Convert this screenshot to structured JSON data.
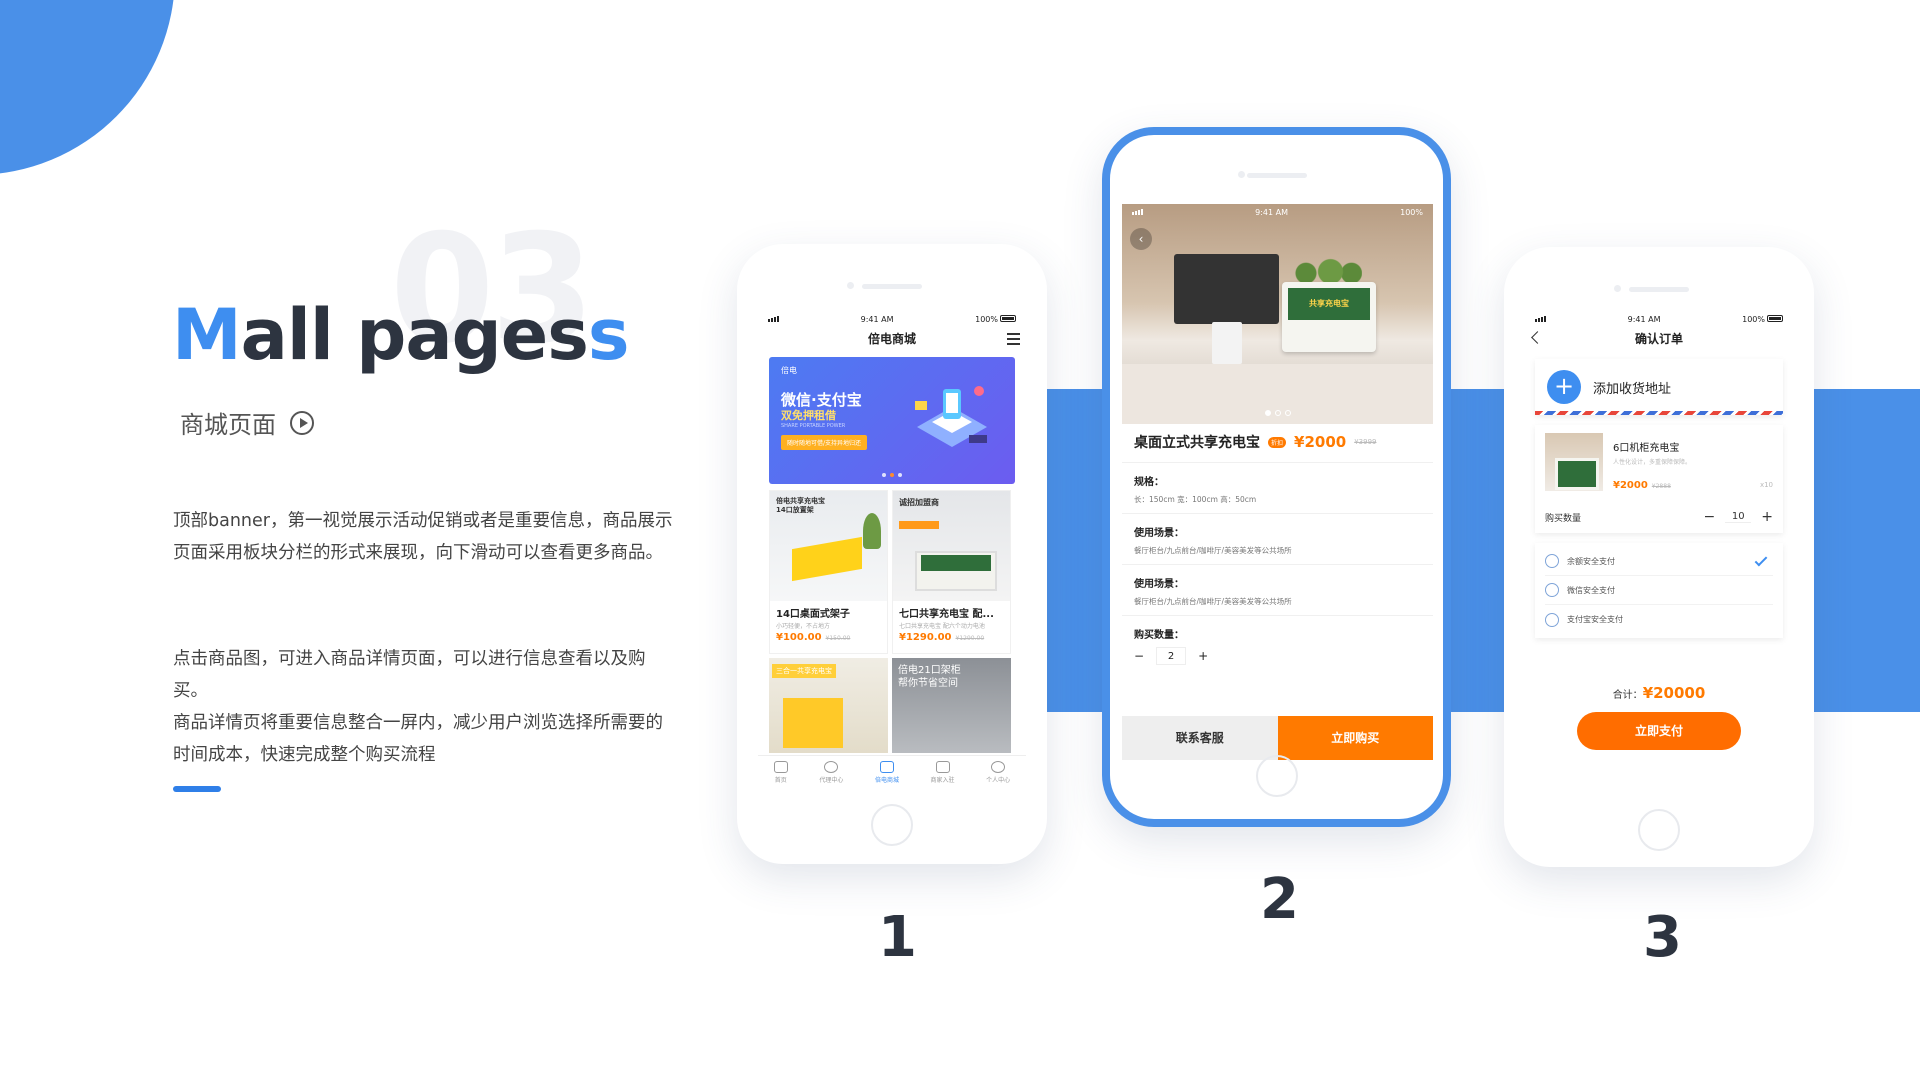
{
  "slide": {
    "number_bg": "03",
    "title_parts": [
      "M",
      "all pages",
      "s"
    ],
    "title_full": "Mall pages",
    "subtitle": "商城页面",
    "desc1": "顶部banner，第一视觉展示活动促销或者是重要信息，商品展示页面采用板块分栏的形式来展现，向下滑动可以查看更多商品。",
    "desc2": "点击商品图，可进入商品详情页面，可以进行信息查看以及购买。\n商品详情页将重要信息整合一屏内，减少用户浏览选择所需要的时间成本，快速完成整个购买流程",
    "labels": [
      "1",
      "2",
      "3"
    ],
    "colors": {
      "accent": "#4a90e8",
      "orange": "#ff7a00",
      "dark": "#2d3440"
    }
  },
  "phone1": {
    "status": {
      "time": "9:41 AM",
      "battery": "100%"
    },
    "title": "倍电商城",
    "banner": {
      "logo": "倍电",
      "line1": "微信·支付宝",
      "line2": "双免押租借",
      "en": "SHARE PORTABLE POWER",
      "button": "随时随地可借/支持异地归还"
    },
    "products": [
      {
        "title": "14口桌面式架子",
        "sub": "小巧轻便，不占地方",
        "price": "¥100.00",
        "old": "¥150.00",
        "img_text": "倍电共享充电宝 14口放置架"
      },
      {
        "title": "七口共享充电宝 配...",
        "sub": "七口共享充电宝 配六个动力电池",
        "price": "¥1290.00",
        "old": "¥1290.00",
        "img_text": "诚招加盟商"
      }
    ],
    "mini": [
      {
        "text": "三合一共享充电宝"
      },
      {
        "text": "倍电21口架柜 帮你节省空间"
      }
    ],
    "tabs": [
      "首页",
      "代理中心",
      "倍电商城",
      "商家入驻",
      "个人中心"
    ]
  },
  "phone2": {
    "status": {
      "time": "9:41 AM",
      "battery": "100%"
    },
    "hero_sign": "共享充电宝",
    "name": "桌面立式共享充电宝",
    "tag": "折扣",
    "price": "¥2000",
    "old_price": "¥3999",
    "spec_label": "规格：",
    "spec_value": "长：150cm   宽：100cm   高：50cm",
    "scene_label": "使用场景：",
    "scene_value": "餐厅柜台/九点前台/咖啡厅/美容美发等公共场所",
    "scene_label2": "使用场景：",
    "scene_value2": "餐厅柜台/九点前台/咖啡厅/美容美发等公共场所",
    "qty_label": "购买数量：",
    "qty_minus": "−",
    "qty": "2",
    "qty_plus": "+",
    "btn_service": "联系客服",
    "btn_buy": "立即购买"
  },
  "phone3": {
    "status": {
      "time": "9:41 AM",
      "battery": "100%"
    },
    "title": "确认订单",
    "add_address": "添加收货地址",
    "item_name": "6口机柜充电宝",
    "item_sub": "人性化设计，多重保障保障。",
    "item_price": "¥2000",
    "item_old": "¥2888",
    "item_qty": "x10",
    "qty_label": "购买数量",
    "qty_minus": "−",
    "qty": "10",
    "qty_plus": "+",
    "pay_methods": [
      "余额安全支付",
      "微信安全支付",
      "支付宝安全支付"
    ],
    "total_label": "合计：",
    "total": "¥20000",
    "pay_button": "立即支付"
  }
}
